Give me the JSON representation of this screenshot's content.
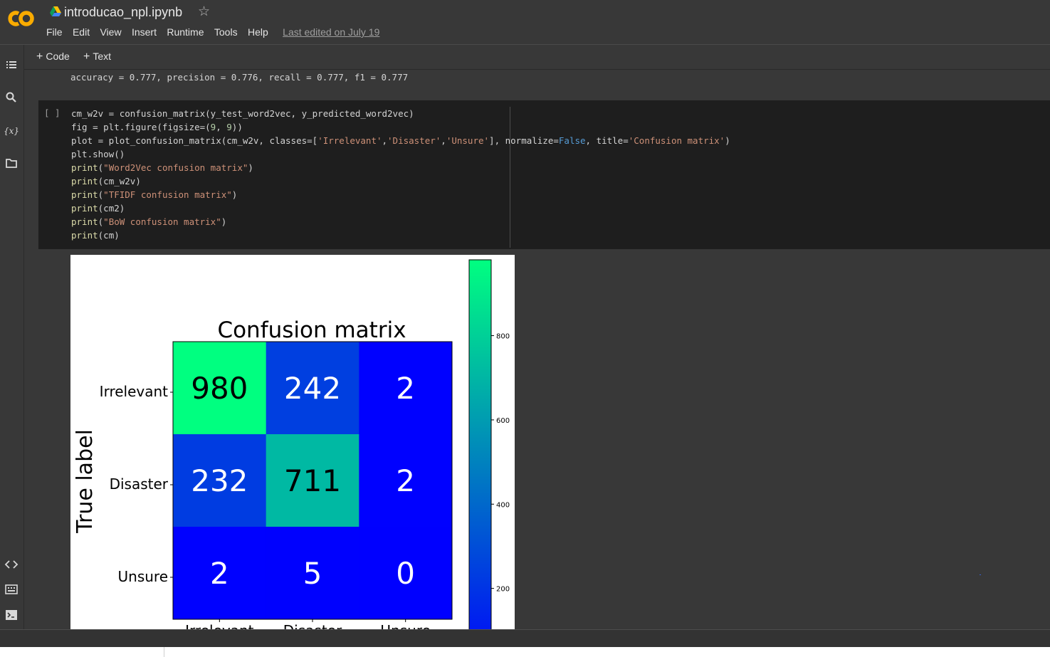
{
  "header": {
    "notebook_title": "introducao_npl.ipynb",
    "logo": "colab-logo",
    "drive_icon": "google-drive-icon",
    "star_icon": "star-outline-icon",
    "menu": [
      "File",
      "Edit",
      "View",
      "Insert",
      "Runtime",
      "Tools",
      "Help"
    ],
    "last_edited": "Last edited on July 19"
  },
  "left_rail": {
    "icons": [
      "table-of-contents-icon",
      "search-icon",
      "variables-icon",
      "files-icon",
      "code-snippets-icon",
      "command-palette-icon",
      "terminal-icon"
    ],
    "variables_glyph": "{x}"
  },
  "toolbar": {
    "add_code": "Code",
    "add_text": "Text",
    "plus_glyph": "+"
  },
  "previous_output": "accuracy = 0.777, precision = 0.776, recall = 0.777, f1 = 0.777",
  "code_cell": {
    "run_indicator": "[ ]",
    "lines": [
      "cm_w2v = confusion_matrix(y_test_word2vec, y_predicted_word2vec)",
      "fig = plt.figure(figsize=(9, 9))",
      "plot = plot_confusion_matrix(cm_w2v, classes=['Irrelevant','Disaster','Unsure'], normalize=False, title='Confusion matrix')",
      "plt.show()",
      "print(\"Word2Vec confusion matrix\")",
      "print(cm_w2v)",
      "print(\"TFIDF confusion matrix\")",
      "print(cm2)",
      "print(\"BoW confusion matrix\")",
      "print(cm)"
    ]
  },
  "chart_data": {
    "type": "heatmap",
    "title": "Confusion matrix",
    "ylabel": "True label",
    "xlabel": "",
    "row_labels": [
      "Irrelevant",
      "Disaster",
      "Unsure"
    ],
    "col_labels": [
      "Irrelevant",
      "Disaster",
      "Unsure"
    ],
    "values": [
      [
        980,
        242,
        2
      ],
      [
        232,
        711,
        2
      ],
      [
        2,
        5,
        0
      ]
    ],
    "colormap": "winter",
    "colormap_colors": [
      "#0000ff",
      "#00ff80"
    ],
    "colorbar": {
      "ticks": [
        200,
        400,
        600,
        800
      ],
      "range": [
        0,
        980
      ]
    },
    "text_colors": {
      "dark_cells": "#000000",
      "light_cells": "#ffffff"
    }
  }
}
